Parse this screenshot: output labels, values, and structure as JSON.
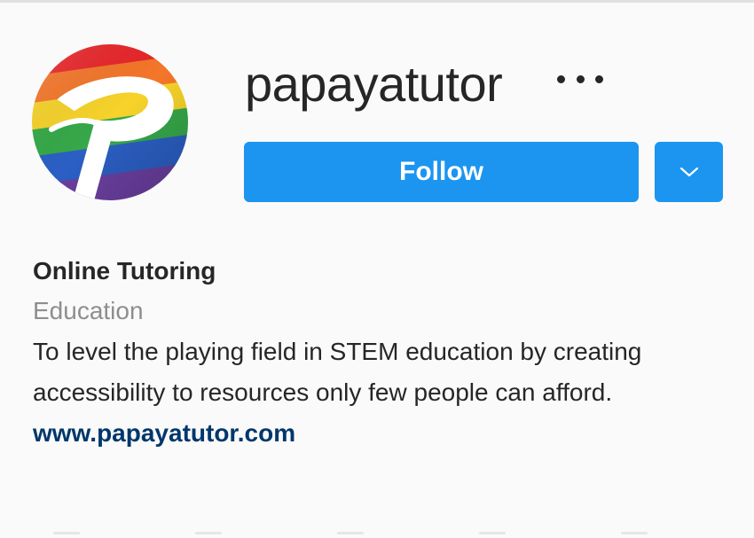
{
  "profile": {
    "username": "papayatutor",
    "avatar_icon": "rainbow-flag-p-logo",
    "more_options_icon": "more-dots-icon"
  },
  "actions": {
    "follow_label": "Follow",
    "dropdown_icon": "chevron-down-icon"
  },
  "bio": {
    "name": "Online Tutoring",
    "category": "Education",
    "description": "To level the playing field in STEM education by creating accessibility to resources only few people can afford.",
    "website": "www.papayatutor.com"
  },
  "colors": {
    "accent": "#1b95f0",
    "text": "#262626",
    "muted": "#8e8e8e",
    "link": "#00376b",
    "background": "#fafafa"
  }
}
